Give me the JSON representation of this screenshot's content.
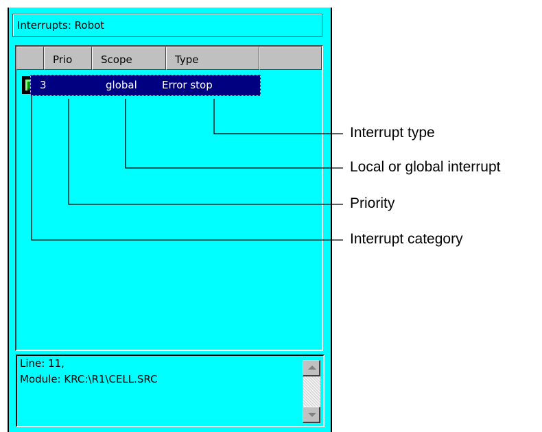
{
  "window": {
    "title": "Interrupts: Robot",
    "background_color": "#00ffff"
  },
  "list": {
    "columns": [
      "",
      "Prio",
      "Scope",
      "Type"
    ],
    "rows": [
      {
        "category_icon": "interrupt-category-icon",
        "prio": "3",
        "scope": "global",
        "type": "Error stop",
        "selected": true
      }
    ]
  },
  "info": {
    "line1": "Line: 11,",
    "line2": "Module: KRC:\\R1\\CELL.SRC"
  },
  "callouts": {
    "type": "Interrupt type",
    "scope": "Local or global interrupt",
    "prio": "Priority",
    "category": "Interrupt category"
  },
  "colors": {
    "selection": "#000080",
    "selection_text": "#ffffff"
  }
}
